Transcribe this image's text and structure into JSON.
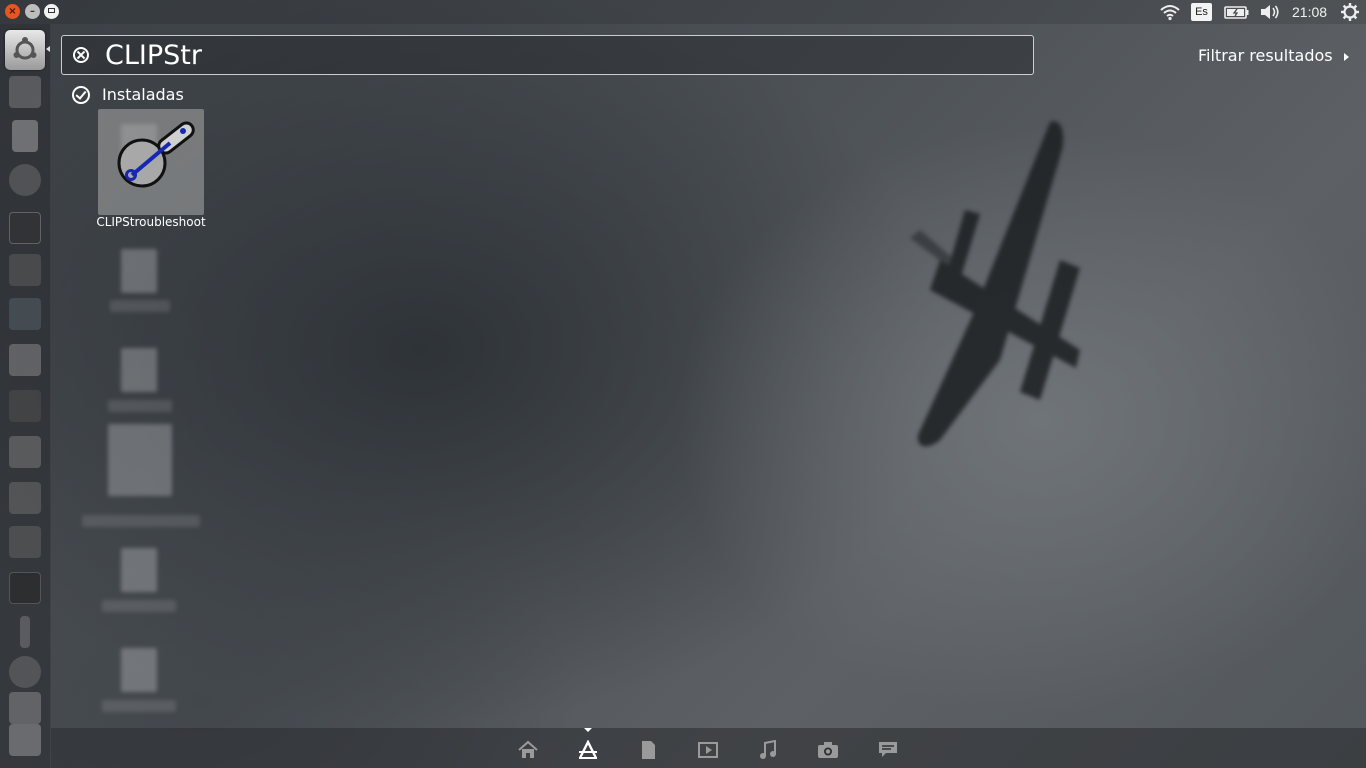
{
  "top_panel": {
    "window_controls": [
      "close",
      "minimize",
      "maximize"
    ],
    "keyboard_layout": "Es",
    "clock": "21:08",
    "indicator_icons": [
      "wifi-icon",
      "keyboard-icon",
      "battery-icon",
      "volume-icon",
      "gear-icon"
    ]
  },
  "launcher": {
    "items": [
      "dash-home",
      "files",
      "text-editor",
      "browser",
      "terminal",
      "image-viewer",
      "app-6",
      "app-7",
      "app-8",
      "app-9",
      "app-10",
      "gpsim",
      "app-12",
      "app-13",
      "app-14",
      "app-15"
    ]
  },
  "search": {
    "query": "CLIPStr",
    "filter_label": "Filtrar resultados"
  },
  "results": {
    "category_label": "Instaladas",
    "items": [
      {
        "label": "CLIPStroubleshoot",
        "icon": "wrench-magnifier-icon"
      }
    ]
  },
  "lenses": [
    "home-lens-icon",
    "apps-lens-icon",
    "files-lens-icon",
    "video-lens-icon",
    "music-lens-icon",
    "photo-lens-icon",
    "social-lens-icon"
  ],
  "colors": {
    "close": "#e95420",
    "accent": "#ffffff",
    "overlay": "#2d2f32"
  }
}
